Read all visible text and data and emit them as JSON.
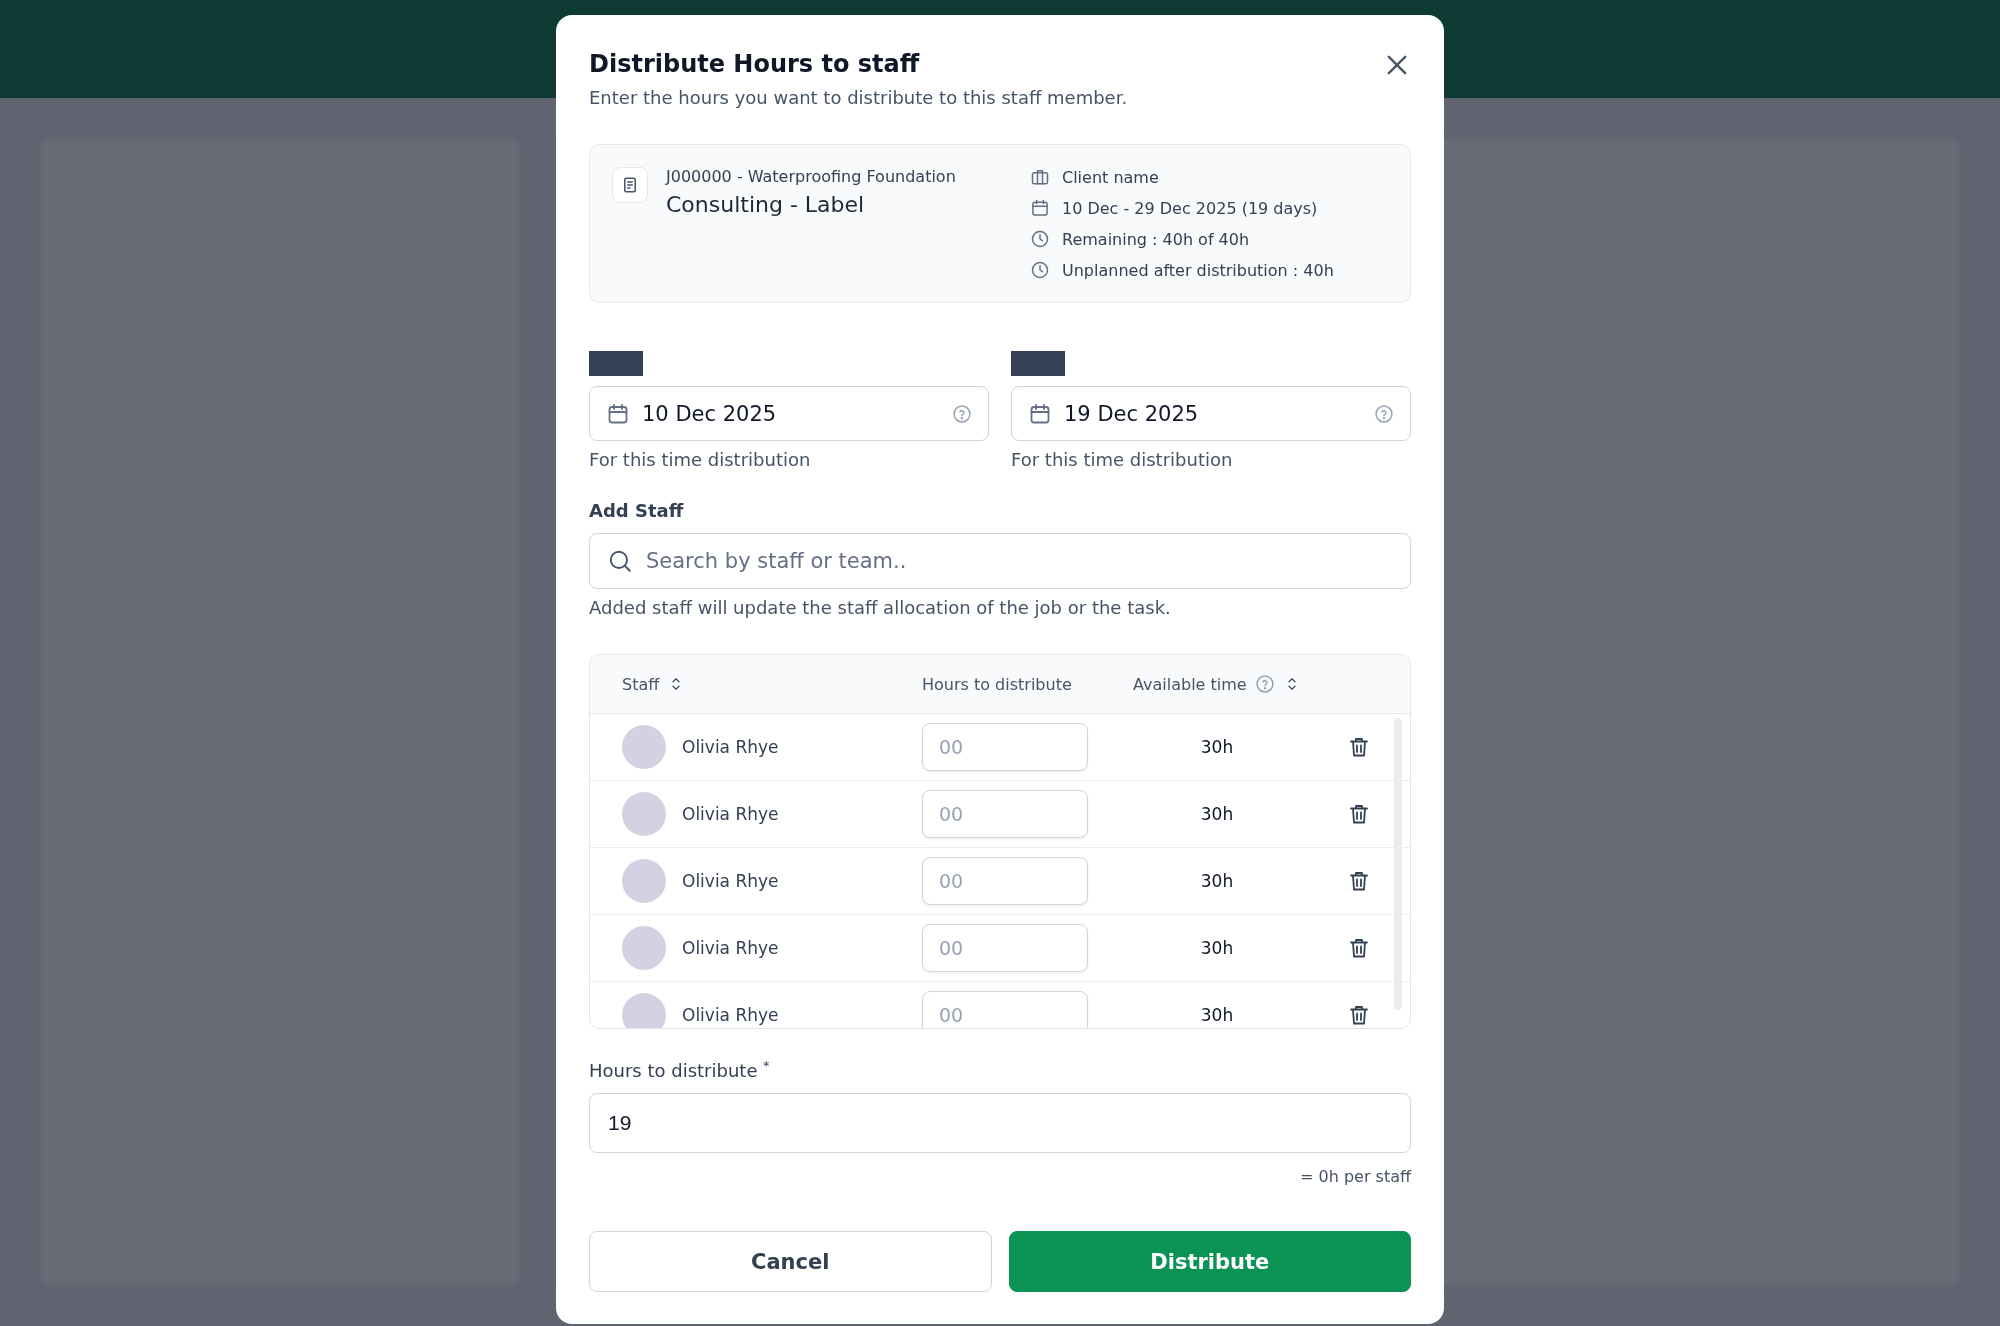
{
  "dialog": {
    "title": "Distribute Hours to staff",
    "subtitle": "Enter the hours you want to distribute to this staff member."
  },
  "job": {
    "code_title": "J000000 - Waterproofing Foundation",
    "name": "Consulting - Label",
    "details": [
      {
        "kind": "client",
        "text": "Client name"
      },
      {
        "kind": "dates",
        "text": "10 Dec -  29 Dec 2025 (19 days)"
      },
      {
        "kind": "time",
        "text": "Remaining : 40h of 40h"
      },
      {
        "kind": "time",
        "text": "Unplanned after distribution : 40h"
      }
    ]
  },
  "date_fields": [
    {
      "value": "10 Dec 2025",
      "hint": "For this time distribution"
    },
    {
      "value": "19 Dec 2025",
      "hint": "For this time distribution"
    }
  ],
  "add_staff": {
    "label": "Add Staff",
    "placeholder": "Search by staff or team..",
    "hint": "Added staff will update the staff allocation of the job or the task."
  },
  "table": {
    "columns": [
      {
        "label": "Staff",
        "kind": "sortable"
      },
      {
        "label": "Hours to distribute",
        "kind": "plain"
      },
      {
        "label": "Available time",
        "kind": "sortable-with-help"
      }
    ],
    "rows": [
      {
        "name": "Olivia Rhye",
        "hours_placeholder": "00",
        "available": "30h"
      },
      {
        "name": "Olivia Rhye",
        "hours_placeholder": "00",
        "available": "30h"
      },
      {
        "name": "Olivia Rhye",
        "hours_placeholder": "00",
        "available": "30h"
      },
      {
        "name": "Olivia Rhye",
        "hours_placeholder": "00",
        "available": "30h"
      },
      {
        "name": "Olivia Rhye",
        "hours_placeholder": "00",
        "available": "30h"
      }
    ]
  },
  "hours": {
    "label": "Hours to distribute",
    "required_mark": "*",
    "value": "19",
    "note": "= 0h per staff"
  },
  "buttons": [
    {
      "label": "Cancel",
      "kind": "secondary"
    },
    {
      "label": "Distribute",
      "kind": "primary"
    }
  ]
}
